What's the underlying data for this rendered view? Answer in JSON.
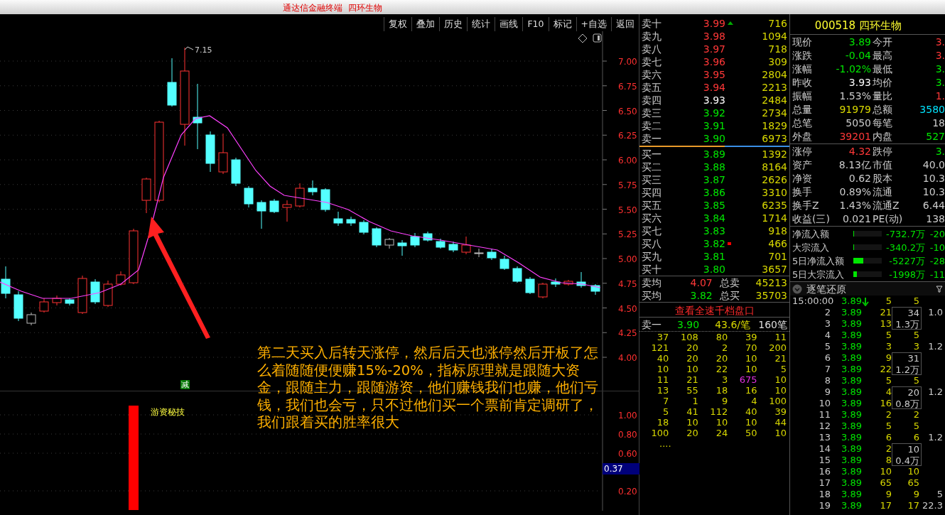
{
  "title_bar": {
    "title": "通达信金融终端  四环生物"
  },
  "toolbar": [
    "复权",
    "叠加",
    "历史",
    "统计",
    "画线",
    "F10",
    "标记",
    "+自选",
    "返回"
  ],
  "chart": {
    "high_label": "7.15",
    "price_axis": [
      "7.00",
      "6.75",
      "6.50",
      "6.25",
      "6.00",
      "5.75",
      "5.50",
      "5.25",
      "5.00",
      "4.75",
      "4.50",
      "4.25",
      "4.00"
    ],
    "signal_badge": "减",
    "annotation": "第二天买入后转天涨停，然后后天也涨停然后开板了怎么着随随便便赚15%-20%，指标原理就是跟随大资金，跟随主力，跟随游资，他们赚钱我们也赚，他们亏钱，我们也会亏，只不过他们买一个票前肯定调研了，我们跟着买的胜率很大"
  },
  "indicator": {
    "name": "游资秘技",
    "axis": [
      "1.00",
      "0.80",
      "0.60",
      "0.20"
    ],
    "current": "0.37"
  },
  "order_book": {
    "asks": [
      {
        "label": "卖十",
        "price": "3.99",
        "color": "#ff3838",
        "volume": "716",
        "kind": "up"
      },
      {
        "label": "卖九",
        "price": "3.98",
        "color": "#ff3838",
        "volume": "1094",
        "kind": "plain"
      },
      {
        "label": "卖八",
        "price": "3.97",
        "color": "#ff3838",
        "volume": "718",
        "kind": "plain"
      },
      {
        "label": "卖七",
        "price": "3.96",
        "color": "#ff3838",
        "volume": "309",
        "kind": "plain"
      },
      {
        "label": "卖六",
        "price": "3.95",
        "color": "#ff3838",
        "volume": "2804",
        "kind": "plain"
      },
      {
        "label": "卖五",
        "price": "3.94",
        "color": "#ff3838",
        "volume": "2213",
        "kind": "plain"
      },
      {
        "label": "卖四",
        "price": "3.93",
        "color": "#ffffff",
        "volume": "2484",
        "kind": "plain"
      },
      {
        "label": "卖三",
        "price": "3.92",
        "color": "#00e600",
        "volume": "2734",
        "kind": "plain"
      },
      {
        "label": "卖二",
        "price": "3.91",
        "color": "#00e600",
        "volume": "1829",
        "kind": "plain"
      },
      {
        "label": "卖一",
        "price": "3.90",
        "color": "#00e600",
        "volume": "6973",
        "kind": "plain"
      }
    ],
    "bids": [
      {
        "label": "买一",
        "price": "3.89",
        "color": "#00e600",
        "volume": "1392",
        "kind": "plain"
      },
      {
        "label": "买二",
        "price": "3.88",
        "color": "#00e600",
        "volume": "8164",
        "kind": "plain"
      },
      {
        "label": "买三",
        "price": "3.87",
        "color": "#00e600",
        "volume": "2626",
        "kind": "plain"
      },
      {
        "label": "买四",
        "price": "3.86",
        "color": "#00e600",
        "volume": "3310",
        "kind": "plain"
      },
      {
        "label": "买五",
        "price": "3.85",
        "color": "#00e600",
        "volume": "6235",
        "kind": "plain"
      },
      {
        "label": "买六",
        "price": "3.84",
        "color": "#00e600",
        "volume": "1714",
        "kind": "plain"
      },
      {
        "label": "买七",
        "price": "3.83",
        "color": "#00e600",
        "volume": "918",
        "kind": "plain"
      },
      {
        "label": "买八",
        "price": "3.82",
        "color": "#00e600",
        "volume": "466",
        "kind": "square"
      },
      {
        "label": "买九",
        "price": "3.81",
        "color": "#00e600",
        "volume": "701",
        "kind": "plain"
      },
      {
        "label": "买十",
        "price": "3.80",
        "color": "#00e600",
        "volume": "3657",
        "kind": "plain"
      }
    ],
    "summary": [
      {
        "label": "卖均",
        "price": "4.07",
        "color": "#ff3838",
        "total_label": "总卖",
        "total": "45213"
      },
      {
        "label": "买均",
        "price": "3.82",
        "color": "#00e600",
        "total_label": "总买",
        "total": "35703"
      }
    ],
    "depth_link": "查看全速千档盘口",
    "queue_header": {
      "label": "卖一",
      "price": "3.90",
      "per_order": "43.6/笔",
      "orders": "160笔"
    },
    "queue": [
      [
        "37",
        "108",
        "80",
        "39",
        "11"
      ],
      [
        "121",
        "20",
        "2",
        "70",
        "200"
      ],
      [
        "40",
        "20",
        "20",
        "10",
        "21"
      ],
      [
        "10",
        "10",
        "22",
        "10",
        "5"
      ],
      [
        "11",
        "21",
        "3",
        {
          "value": "675",
          "large": true
        },
        "10"
      ],
      [
        "13",
        "55",
        "18",
        "16",
        "10"
      ],
      [
        "7",
        "1",
        "9",
        "4",
        "100"
      ],
      [
        "5",
        "41",
        "112",
        "40",
        "39"
      ],
      [
        "18",
        "10",
        "10",
        "10",
        "44"
      ],
      [
        "100",
        "20",
        "24",
        "50",
        "10"
      ]
    ],
    "queue_more": "...."
  },
  "quote": {
    "code": "000518",
    "name": "四环生物",
    "rows": [
      {
        "left": {
          "label": "现价",
          "value": "3.89",
          "color": "#00e600"
        },
        "right": {
          "label": "今开",
          "value": "3.",
          "color": "#ff3838"
        }
      },
      {
        "left": {
          "label": "涨跌",
          "value": "-0.04",
          "color": "#00e600"
        },
        "right": {
          "label": "最高",
          "value": "3.",
          "color": "#ff3838"
        }
      },
      {
        "left": {
          "label": "涨幅",
          "value": "-1.02%",
          "color": "#00e600"
        },
        "right": {
          "label": "最低",
          "value": "3.",
          "color": "#00e600"
        }
      },
      {
        "left": {
          "label": "昨收",
          "value": "3.93",
          "color": "#ffffff"
        },
        "right": {
          "label": "均价",
          "value": "3.",
          "color": "#00e600"
        }
      },
      {
        "left": {
          "label": "振幅",
          "value": "1.53%",
          "color": "#cccccc"
        },
        "right": {
          "label": "量比",
          "value": "1.",
          "color": "#ff3838"
        }
      },
      {
        "left": {
          "label": "总量",
          "value": "91979",
          "color": "#d8d800"
        },
        "right": {
          "label": "总额",
          "value": "3580",
          "color": "#00e5ff"
        }
      },
      {
        "left": {
          "label": "总笔",
          "value": "5050",
          "color": "#cccccc"
        },
        "right": {
          "label": "每笔",
          "value": "18",
          "color": "#cccccc"
        }
      },
      {
        "left": {
          "label": "外盘",
          "value": "39201",
          "color": "#ff3838"
        },
        "right": {
          "label": "内盘",
          "value": "527",
          "color": "#00e600"
        }
      }
    ],
    "fundamentals": [
      {
        "left": {
          "label": "涨停",
          "value": "4.32",
          "color": "#ff3838"
        },
        "right": {
          "label": "跌停",
          "value": "3.",
          "color": "#00e600"
        }
      },
      {
        "left": {
          "label": "资产",
          "value": "8.13亿",
          "color": "#cccccc"
        },
        "right": {
          "label": "市值",
          "value": "40.0",
          "color": "#cccccc"
        }
      },
      {
        "left": {
          "label": "净资",
          "value": "0.62",
          "color": "#cccccc"
        },
        "right": {
          "label": "股本",
          "value": "10.3",
          "color": "#cccccc"
        }
      },
      {
        "left": {
          "label": "换手",
          "value": "0.89%",
          "color": "#cccccc"
        },
        "right": {
          "label": "流通",
          "value": "10.3",
          "color": "#cccccc"
        }
      },
      {
        "left": {
          "label": "换手Z",
          "value": "1.43%",
          "color": "#cccccc"
        },
        "right": {
          "label": "流通Z",
          "value": "6.44",
          "color": "#cccccc"
        }
      },
      {
        "left": {
          "label": "收益(三)",
          "value": "0.021",
          "color": "#cccccc"
        },
        "right": {
          "label": "PE(动)",
          "value": "138",
          "color": "#cccccc"
        }
      }
    ],
    "flows": [
      {
        "label": "净流入额",
        "level": 0.03,
        "value": "-732.7万",
        "value2": "-20"
      },
      {
        "label": "大宗流入",
        "level": 0.03,
        "value": "-340.2万",
        "value2": "-10"
      },
      {
        "label": "5日净流入额",
        "level": 0.35,
        "value": "-5227万",
        "value2": "-28"
      },
      {
        "label": "5日大宗流入",
        "level": 0.12,
        "value": "-1998万",
        "value2": "-11"
      }
    ]
  },
  "ticks": {
    "title": "逐笔还原",
    "rows": [
      {
        "time": "15:00:00",
        "price": "3.89",
        "volume": "5",
        "kind": "down",
        "count": "5"
      },
      {
        "time": "2",
        "price": "3.89",
        "volume": "21",
        "box": {
          "count": "34",
          "amount": "1.3万"
        },
        "side": "1.0"
      },
      {
        "time": "3",
        "price": "3.89",
        "volume": "13"
      },
      {
        "time": "4",
        "price": "3.89",
        "volume": "5",
        "count": "5"
      },
      {
        "time": "5",
        "price": "3.89",
        "volume": "3",
        "count": "3",
        "side": "1.2"
      },
      {
        "time": "6",
        "price": "3.89",
        "volume": "9",
        "box": {
          "count": "31",
          "amount": "1.2万"
        }
      },
      {
        "time": "7",
        "price": "3.89",
        "volume": "22"
      },
      {
        "time": "8",
        "price": "3.89",
        "volume": "5",
        "count": "5"
      },
      {
        "time": "9",
        "price": "3.89",
        "volume": "4",
        "box": {
          "count": "20",
          "amount": "0.8万"
        },
        "side": "1.2"
      },
      {
        "time": "10",
        "price": "3.89",
        "volume": "16"
      },
      {
        "time": "11",
        "price": "3.89",
        "volume": "2",
        "count": "2"
      },
      {
        "time": "12",
        "price": "3.89",
        "volume": "5",
        "count": "5"
      },
      {
        "time": "13",
        "price": "3.89",
        "volume": "6",
        "count": "6",
        "side": "1.2"
      },
      {
        "time": "14",
        "price": "3.89",
        "volume": "2",
        "box": {
          "count": "10",
          "amount": "0.4万"
        }
      },
      {
        "time": "15",
        "price": "3.89",
        "volume": "8"
      },
      {
        "time": "16",
        "price": "3.89",
        "volume": "10",
        "count": "10"
      },
      {
        "time": "17",
        "price": "3.89",
        "volume": "65",
        "count": "65"
      },
      {
        "time": "18",
        "price": "3.89",
        "volume": "9",
        "count": "9",
        "side": "5"
      },
      {
        "time": "19",
        "price": "3.89",
        "volume": "17",
        "count": "17",
        "side": "22.3"
      }
    ]
  }
}
